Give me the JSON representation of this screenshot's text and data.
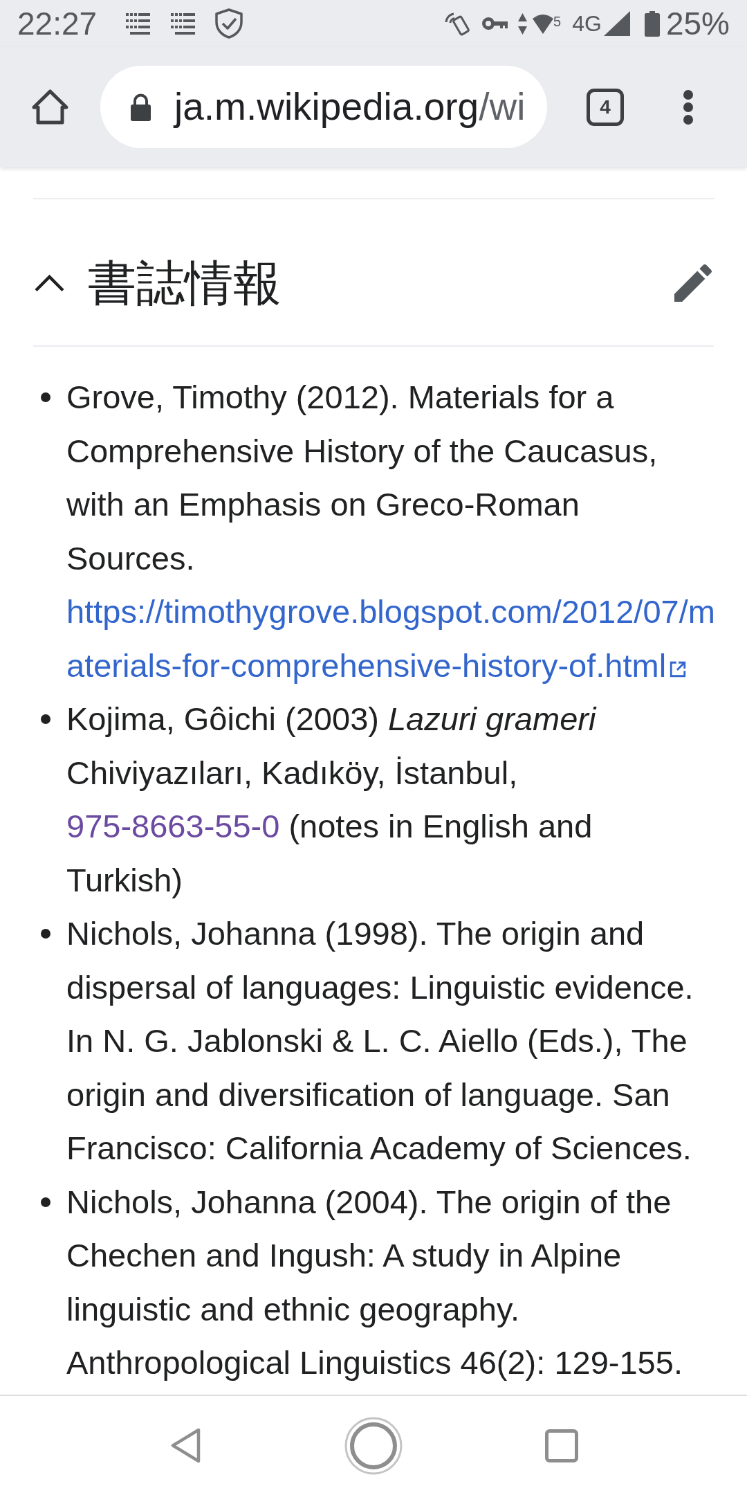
{
  "status_bar": {
    "time": "22:27",
    "wifi_badge": "5",
    "network": "4G",
    "battery": "25%"
  },
  "browser": {
    "url_domain": "ja.m.wikipedia.org",
    "url_path": "/wi",
    "tab_count": "4"
  },
  "section": {
    "title": "書誌情報",
    "expanded": true
  },
  "references": [
    {
      "parts": [
        {
          "kind": "text",
          "text": "Grove, Timothy (2012). Materials for a Comprehensive History of the Caucasus, with an Emphasis on Greco-Roman Sources."
        },
        {
          "kind": "external_link",
          "text": "https://timothygrove.blogspot.com/2012/07/materials-for-comprehensive-history-of.html",
          "visited": false
        }
      ]
    },
    {
      "parts": [
        {
          "kind": "text",
          "text": "Kojima, Gôichi (2003) *Lazuri grameri* Chiviyazıları, Kadıköy, İstanbul,"
        },
        {
          "kind": "link",
          "text": "975-8663-55-0",
          "visited": true
        },
        {
          "kind": "text",
          "text": "(notes in English and Turkish)"
        }
      ]
    },
    {
      "parts": [
        {
          "kind": "text",
          "text": "Nichols, Johanna (1998). The origin and dispersal of languages: Linguistic evidence. In N. G. Jablonski & L. C. Aiello (Eds.), The origin and diversification of language. San Francisco: California Academy of Sciences."
        }
      ]
    },
    {
      "parts": [
        {
          "kind": "text",
          "text": "Nichols, Johanna (2004). The origin of the Chechen and Ingush: A study in Alpine linguistic and ethnic geography. Anthropological Linguistics 46(2): 129-155."
        }
      ]
    }
  ]
}
